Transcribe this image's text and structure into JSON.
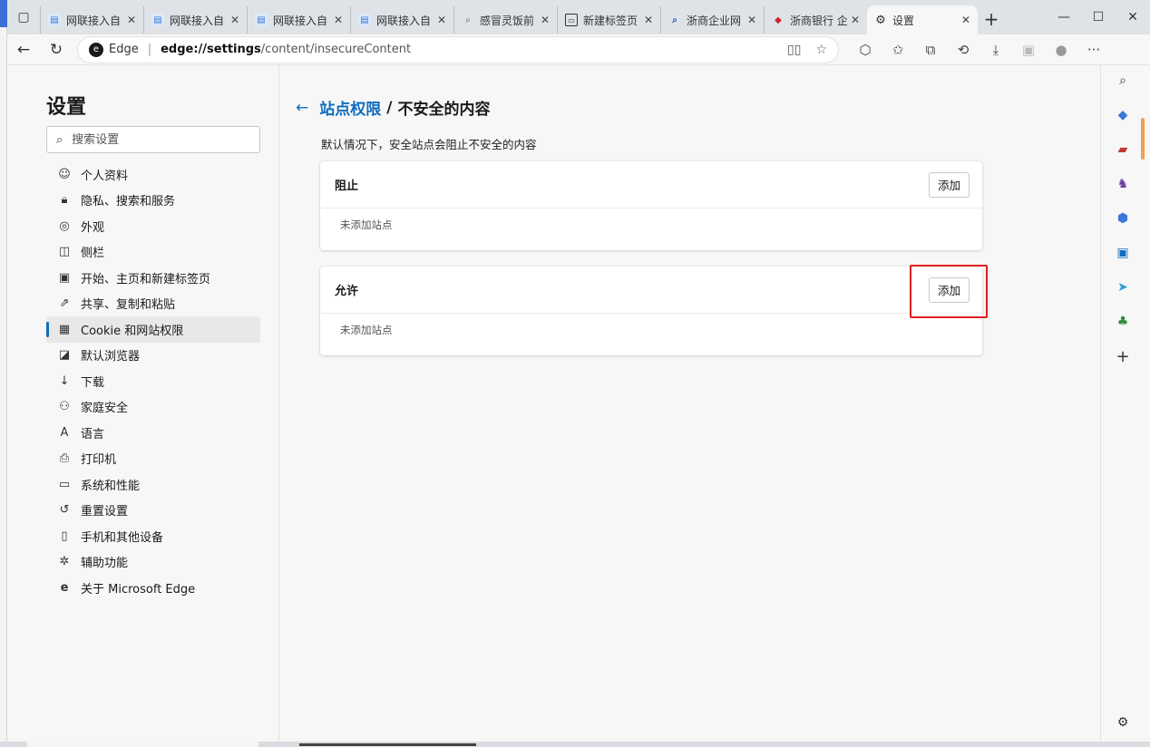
{
  "browser": {
    "tabs": [
      {
        "label": "网联接入自",
        "favicon": "doc-icon",
        "active": false
      },
      {
        "label": "网联接入自",
        "favicon": "doc-icon",
        "active": false
      },
      {
        "label": "网联接入自",
        "favicon": "doc-icon",
        "active": false
      },
      {
        "label": "网联接入自",
        "favicon": "doc-icon",
        "active": false
      },
      {
        "label": "感冒灵饭前",
        "favicon": "search-icon",
        "active": false
      },
      {
        "label": "新建标签页",
        "favicon": "newtab-icon",
        "active": false
      },
      {
        "label": "浙商企业网",
        "favicon": "search-icon",
        "active": false
      },
      {
        "label": "浙商银行 企",
        "favicon": "bank-icon",
        "active": false
      },
      {
        "label": "设置",
        "favicon": "gear-icon",
        "active": true
      }
    ],
    "address": {
      "brand": "Edge",
      "url_host": "edge://settings",
      "url_rest": "/content/insecureContent"
    }
  },
  "sidebar": {
    "title": "设置",
    "search_placeholder": "搜索设置",
    "items": [
      {
        "label": "个人资料",
        "icon": "profile-icon"
      },
      {
        "label": "隐私、搜索和服务",
        "icon": "lock-icon"
      },
      {
        "label": "外观",
        "icon": "palette-icon"
      },
      {
        "label": "侧栏",
        "icon": "sidebar-icon"
      },
      {
        "label": "开始、主页和新建标签页",
        "icon": "home-icon"
      },
      {
        "label": "共享、复制和粘贴",
        "icon": "share-icon"
      },
      {
        "label": "Cookie 和网站权限",
        "icon": "cookie-icon",
        "active": true
      },
      {
        "label": "默认浏览器",
        "icon": "browser-icon"
      },
      {
        "label": "下载",
        "icon": "download-icon"
      },
      {
        "label": "家庭安全",
        "icon": "family-icon"
      },
      {
        "label": "语言",
        "icon": "language-icon"
      },
      {
        "label": "打印机",
        "icon": "printer-icon"
      },
      {
        "label": "系统和性能",
        "icon": "laptop-icon"
      },
      {
        "label": "重置设置",
        "icon": "reset-icon"
      },
      {
        "label": "手机和其他设备",
        "icon": "phone-icon"
      },
      {
        "label": "辅助功能",
        "icon": "accessibility-icon"
      },
      {
        "label": "关于 Microsoft Edge",
        "icon": "edge-icon"
      }
    ]
  },
  "main": {
    "breadcrumb_link": "站点权限",
    "breadcrumb_sep": "/",
    "breadcrumb_current": "不安全的内容",
    "description": "默认情况下，安全站点会阻止不安全的内容",
    "block": {
      "title": "阻止",
      "add_label": "添加",
      "empty": "未添加站点"
    },
    "allow": {
      "title": "允许",
      "add_label": "添加",
      "empty": "未添加站点"
    }
  },
  "colors": {
    "accent": "#0f6cbd",
    "highlight": "#e02020"
  }
}
